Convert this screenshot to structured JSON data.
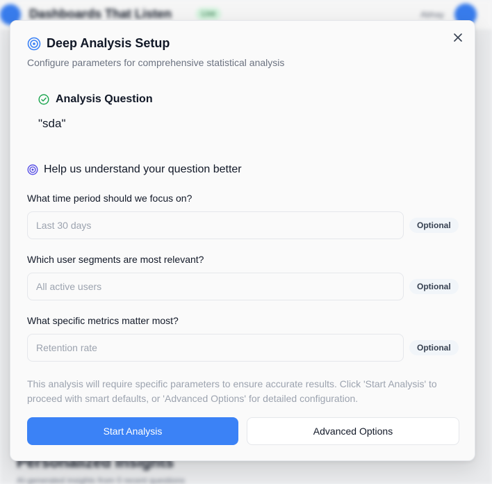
{
  "background": {
    "app_title": "Dashboards That Listen",
    "live_badge": "Live",
    "user_label": "Abhay",
    "section_title": "Personalized Insights",
    "section_subtitle": "AI-generated insights from 0 recent questions"
  },
  "modal": {
    "title": "Deep Analysis Setup",
    "subtitle": "Configure parameters for comprehensive statistical analysis",
    "question_header": "Analysis Question",
    "question_text": "\"sda\"",
    "help_header": "Help us understand your question better",
    "fields": [
      {
        "label": "What time period should we focus on?",
        "placeholder": "Last 30 days",
        "value": "",
        "badge": "Optional"
      },
      {
        "label": "Which user segments are most relevant?",
        "placeholder": "All active users",
        "value": "",
        "badge": "Optional"
      },
      {
        "label": "What specific metrics matter most?",
        "placeholder": "Retention rate",
        "value": "",
        "badge": "Optional"
      }
    ],
    "info_text": "This analysis will require specific parameters to ensure accurate results. Click 'Start Analysis' to proceed with smart defaults, or 'Advanced Options' for detailed configuration.",
    "primary_button": "Start Analysis",
    "secondary_button": "Advanced Options"
  },
  "icons": {
    "close": "close-icon",
    "title": "target-icon",
    "question": "check-circle-icon",
    "help": "target-icon"
  },
  "colors": {
    "accent": "#3b82f6",
    "success": "#16a34a",
    "target": "#4f46e5"
  }
}
